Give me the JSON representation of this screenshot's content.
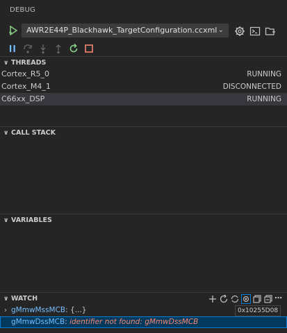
{
  "panel_title": "DEBUG",
  "launch": {
    "config": "AWR2E44P_Blackhawk_TargetConfiguration.ccxml"
  },
  "icons": {
    "start": "play-icon",
    "dropdown": "chevron-down-icon",
    "settings": "gear-icon",
    "console": "terminal-icon",
    "add_config": "add-folder-icon",
    "pause": "pause-icon",
    "step_over": "step-over-icon",
    "step_into": "step-into-icon",
    "step_out": "step-out-icon",
    "restart": "restart-icon",
    "stop": "stop-icon"
  },
  "sections": {
    "threads": "THREADS",
    "call_stack": "CALL STACK",
    "variables": "VARIABLES",
    "watch": "WATCH"
  },
  "threads": [
    {
      "name": "Cortex_R5_0",
      "state": "RUNNING"
    },
    {
      "name": "Cortex_M4_1",
      "state": "DISCONNECTED"
    },
    {
      "name": "C66xx_DSP",
      "state": "RUNNING"
    }
  ],
  "watch": {
    "tooltip": "0x10255D08",
    "items": [
      {
        "expr": "gMmwMssMCB",
        "sep": ": ",
        "value": "{...}"
      },
      {
        "expr": "gMmwDssMCB",
        "sep": ": ",
        "value": "identifier not found: gMmwDssMCB"
      }
    ]
  },
  "colors": {
    "background": "#252526",
    "accent_green": "#89d185",
    "accent_blue": "#75beff",
    "stop_red": "#f48771",
    "selection": "#04395e"
  }
}
